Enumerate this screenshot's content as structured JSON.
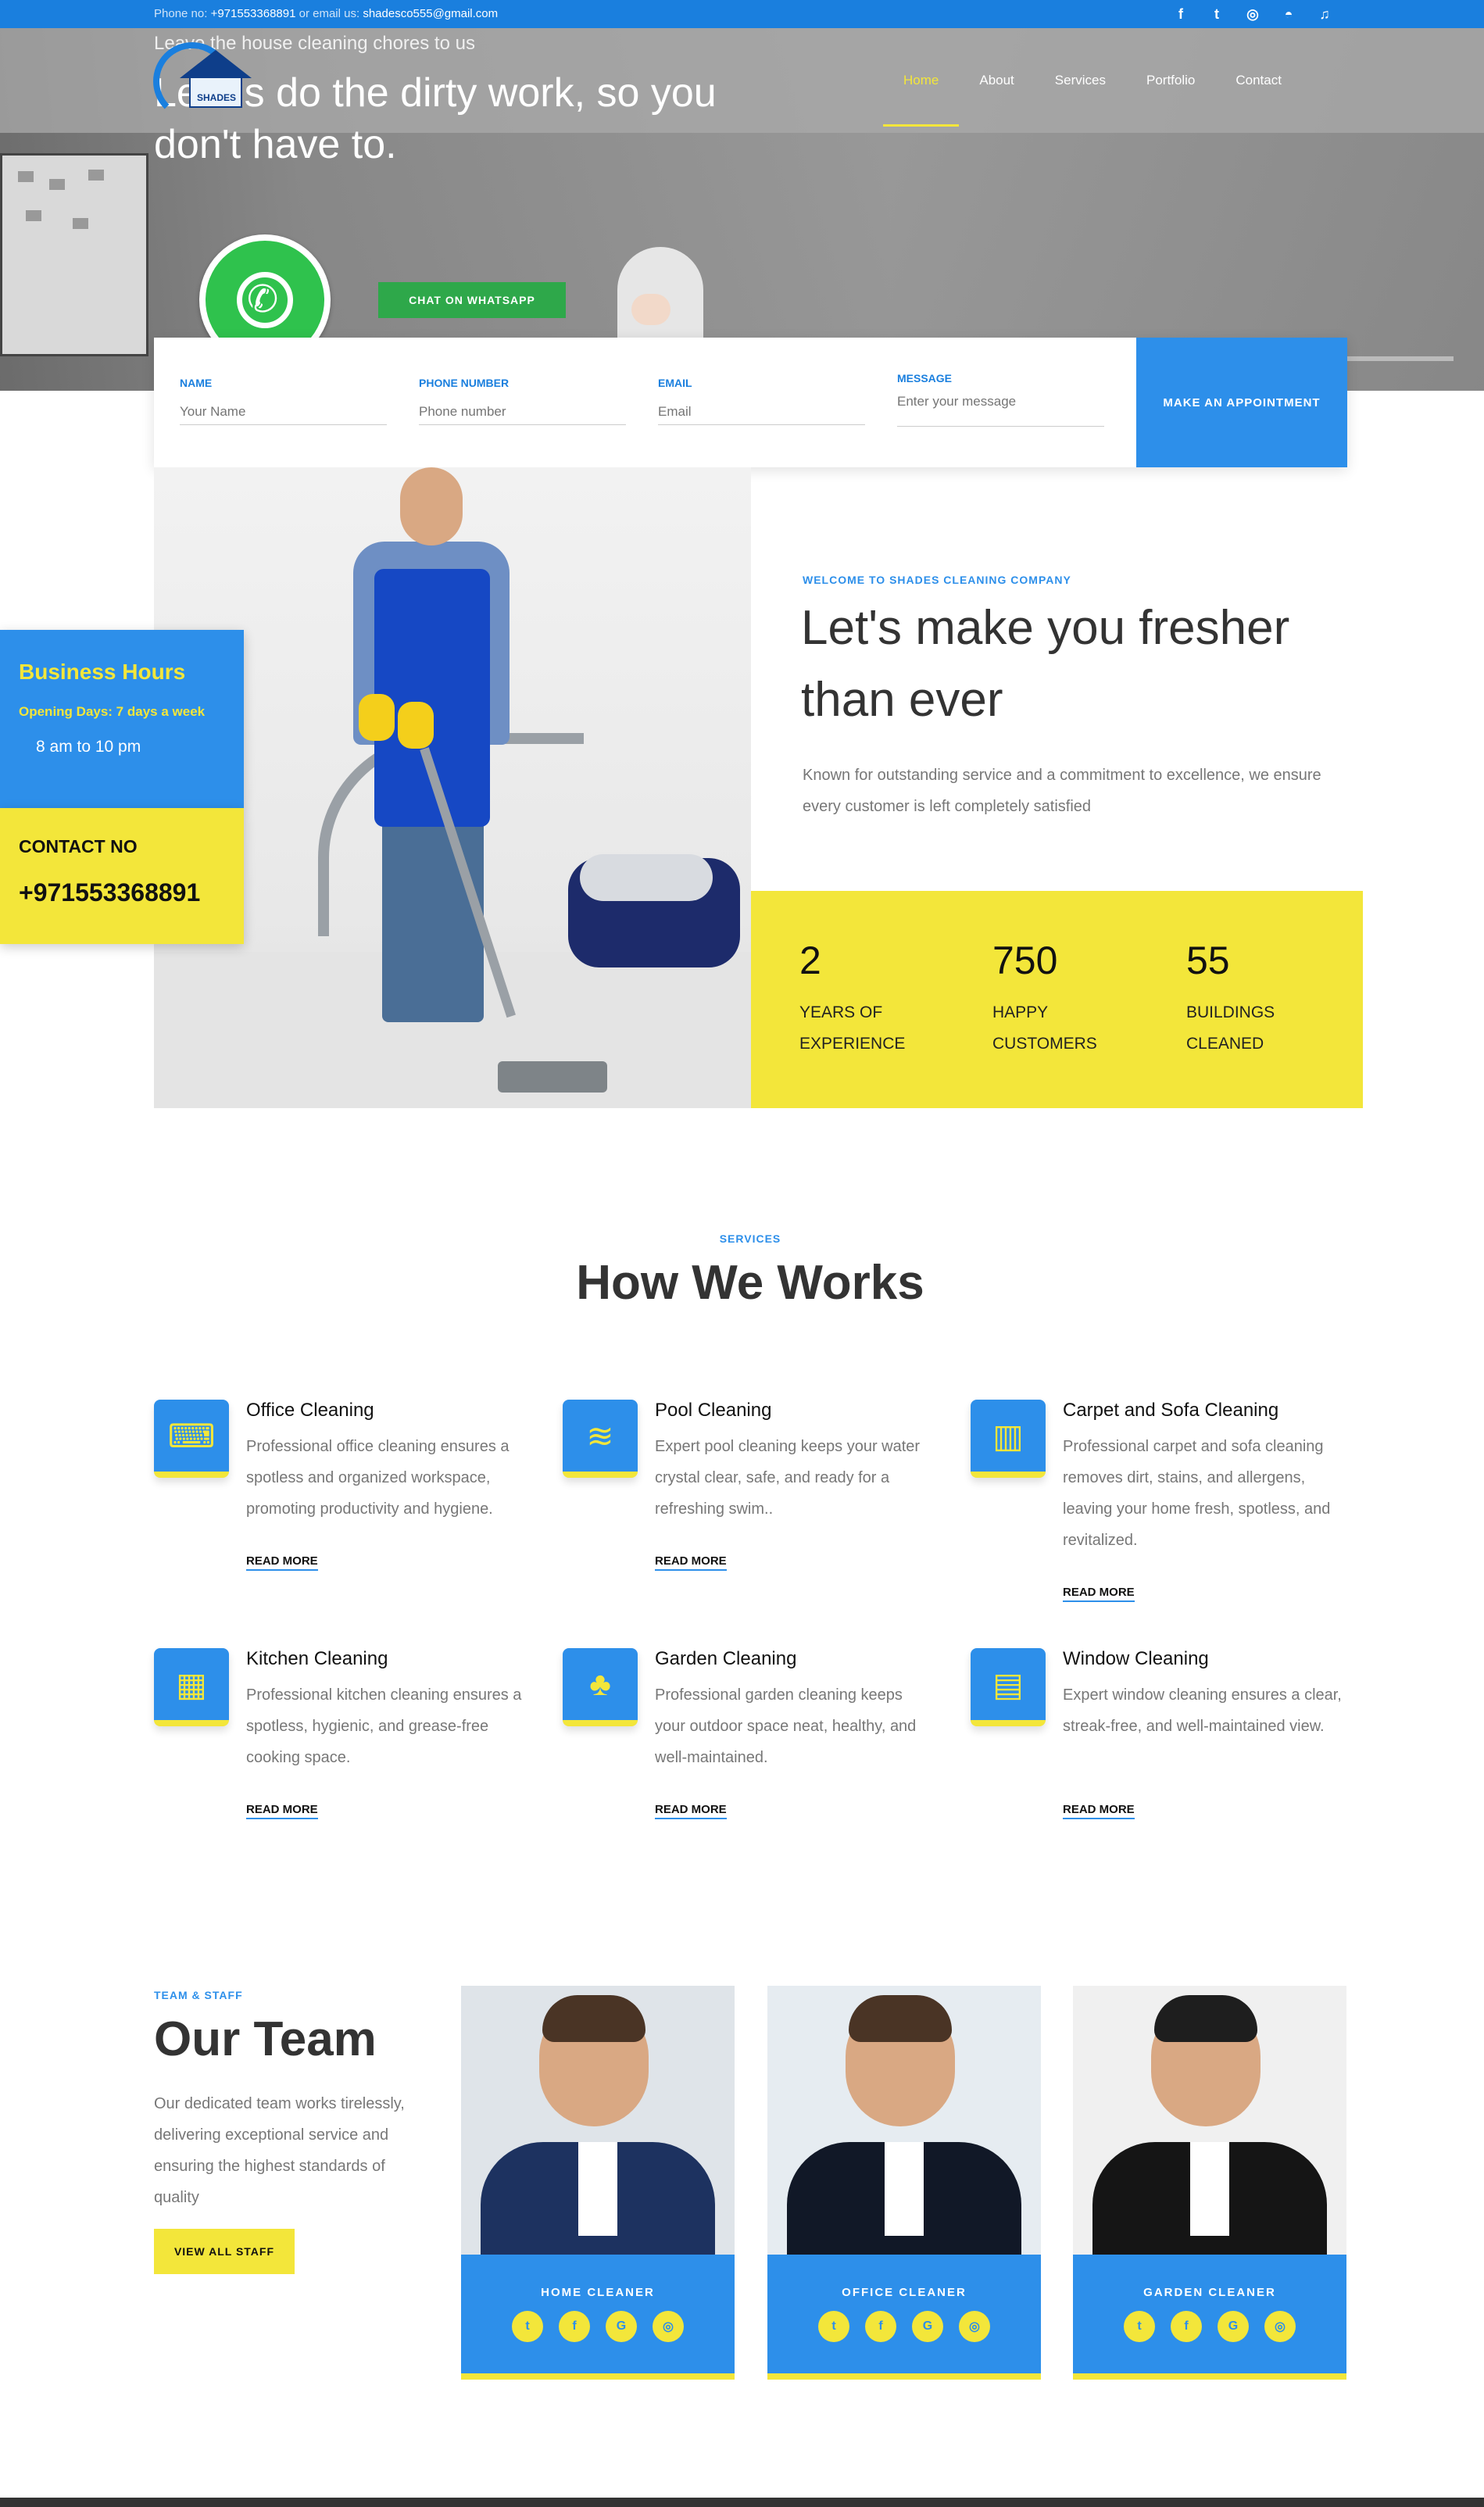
{
  "topbar": {
    "phone_label": "Phone no:",
    "phone": "+971553368891",
    "email_label": "or email us:",
    "email": "shadesco555@gmail.com",
    "socials": [
      {
        "name": "facebook-icon",
        "glyph": "f"
      },
      {
        "name": "twitter-icon",
        "glyph": "t"
      },
      {
        "name": "instagram-icon",
        "glyph": "◎"
      },
      {
        "name": "snapchat-icon",
        "glyph": "◓"
      },
      {
        "name": "tiktok-icon",
        "glyph": "♫"
      }
    ]
  },
  "logo": {
    "text": "SHADES"
  },
  "nav": {
    "items": [
      "Home",
      "About",
      "Services",
      "Portfolio",
      "Contact"
    ],
    "active": "Home"
  },
  "hero": {
    "subtitle": "Leave the house cleaning chores to us",
    "title": "Let us do the dirty work, so you don't have to.",
    "whatsapp_button": "CHAT ON WHATSAPP"
  },
  "form": {
    "name_label": "NAME",
    "name_placeholder": "Your Name",
    "phone_label": "PHONE NUMBER",
    "phone_placeholder": "Phone number",
    "email_label": "EMAIL",
    "email_placeholder": "Email",
    "message_label": "MESSAGE",
    "message_placeholder": "Enter your message",
    "submit": "MAKE AN APPOINTMENT"
  },
  "hours": {
    "title": "Business Hours",
    "days": "Opening Days: 7 days a week",
    "time": "8 am to 10 pm"
  },
  "contact": {
    "label": "CONTACT NO",
    "number": "+971553368891"
  },
  "about": {
    "eyebrow": "WELCOME TO SHADES CLEANING COMPANY",
    "title": "Let's make you fresher than ever",
    "text": "Known for outstanding service and a commitment to excellence, we ensure every customer is left completely satisfied"
  },
  "stats": [
    {
      "num": "2",
      "line1": "YEARS OF",
      "line2": "EXPERIENCE"
    },
    {
      "num": "750",
      "line1": "HAPPY",
      "line2": "CUSTOMERS"
    },
    {
      "num": "55",
      "line1": "BUILDINGS",
      "line2": "CLEANED"
    }
  ],
  "services": {
    "eyebrow": "SERVICES",
    "title": "How We Works",
    "items": [
      {
        "title": "Office Cleaning",
        "text": "Professional office cleaning ensures a spotless and organized workspace, promoting productivity and hygiene.",
        "more": "READ MORE",
        "icon": "office-icon",
        "glyph": "⌨"
      },
      {
        "title": "Pool Cleaning",
        "text": "Expert pool cleaning keeps your water crystal clear, safe, and ready for a refreshing swim..",
        "more": "READ MORE",
        "icon": "pool-icon",
        "glyph": "≋"
      },
      {
        "title": "Carpet and Sofa Cleaning",
        "text": "Professional carpet and sofa cleaning removes dirt, stains, and allergens, leaving your home fresh, spotless, and revitalized.",
        "more": "READ MORE",
        "icon": "carpet-icon",
        "glyph": "▥"
      },
      {
        "title": "Kitchen Cleaning",
        "text": "Professional kitchen cleaning ensures a spotless, hygienic, and grease-free cooking space.",
        "more": "READ MORE",
        "icon": "kitchen-icon",
        "glyph": "▦"
      },
      {
        "title": "Garden Cleaning",
        "text": "Professional garden cleaning keeps your outdoor space neat, healthy, and well-maintained.",
        "more": "READ MORE",
        "icon": "garden-icon",
        "glyph": "♣"
      },
      {
        "title": "Window Cleaning",
        "text": "Expert window cleaning ensures a clear, streak-free, and well-maintained view.",
        "more": "READ MORE",
        "icon": "window-icon",
        "glyph": "▤"
      }
    ]
  },
  "team": {
    "eyebrow": "TEAM & STAFF",
    "title": "Our Team",
    "text": "Our dedicated team works tirelessly, delivering exceptional service and ensuring the highest standards of quality",
    "button": "VIEW ALL STAFF",
    "members": [
      {
        "role": "HOME CLEANER"
      },
      {
        "role": "OFFICE CLEANER"
      },
      {
        "role": "GARDEN CLEANER"
      }
    ],
    "socials": [
      {
        "name": "twitter-icon",
        "glyph": "t"
      },
      {
        "name": "facebook-icon",
        "glyph": "f"
      },
      {
        "name": "google-icon",
        "glyph": "G"
      },
      {
        "name": "instagram-icon",
        "glyph": "◎"
      }
    ]
  },
  "colors": {
    "blue": "#2d8fea",
    "topbar_blue": "#1a7fde",
    "yellow": "#f3e63a",
    "whatsapp_green": "#2ea84a"
  }
}
